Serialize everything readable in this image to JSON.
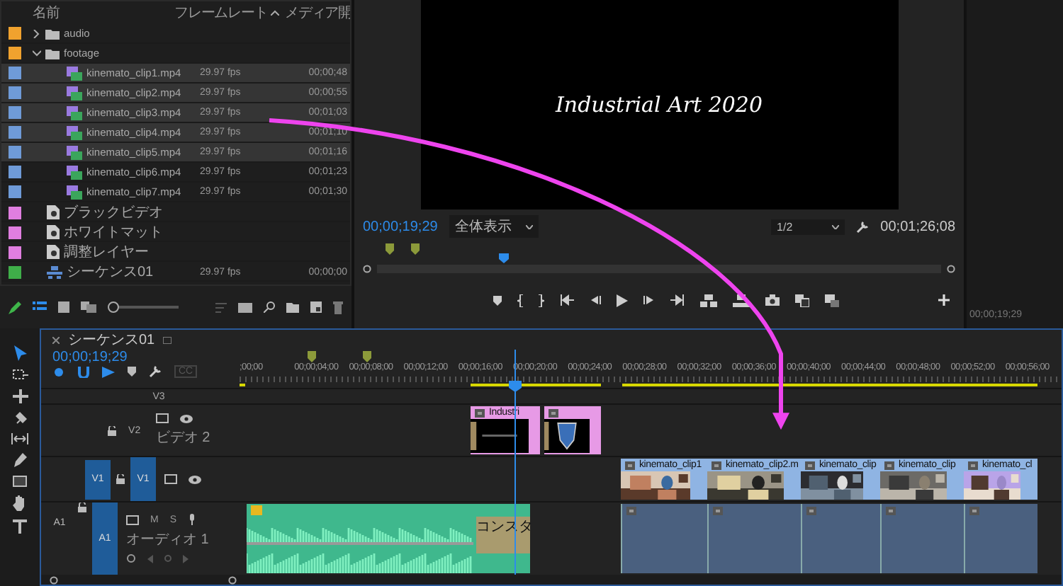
{
  "project": {
    "columns": [
      "名前",
      "フレームレート",
      "メディア開"
    ],
    "zoom_slider": {
      "level": 0
    },
    "items": [
      {
        "kind": "folder",
        "name": "audio",
        "color": "#f0a22e",
        "expanded": false,
        "selected": false
      },
      {
        "kind": "folder",
        "name": "footage",
        "color": "#f0a22e",
        "expanded": true,
        "selected": false,
        "children": [
          {
            "kind": "clip",
            "name": "kinemato_clip1.mp4",
            "rate": "29.97 fps",
            "duration": "00;00;48",
            "color": "#6f9bd8",
            "selected": true
          },
          {
            "kind": "clip",
            "name": "kinemato_clip2.mp4",
            "rate": "29.97 fps",
            "duration": "00;00;55",
            "color": "#6f9bd8",
            "selected": true
          },
          {
            "kind": "clip",
            "name": "kinemato_clip3.mp4",
            "rate": "29.97 fps",
            "duration": "00;01;03",
            "color": "#6f9bd8",
            "selected": true
          },
          {
            "kind": "clip",
            "name": "kinemato_clip4.mp4",
            "rate": "29.97 fps",
            "duration": "00;01;10",
            "color": "#6f9bd8",
            "selected": true
          },
          {
            "kind": "clip",
            "name": "kinemato_clip5.mp4",
            "rate": "29.97 fps",
            "duration": "00;01;16",
            "color": "#6f9bd8",
            "selected": true
          },
          {
            "kind": "clip",
            "name": "kinemato_clip6.mp4",
            "rate": "29.97 fps",
            "duration": "00;01;23",
            "color": "#6f9bd8",
            "selected": false
          },
          {
            "kind": "clip",
            "name": "kinemato_clip7.mp4",
            "rate": "29.97 fps",
            "duration": "00;01;30",
            "color": "#6f9bd8",
            "selected": false
          }
        ]
      },
      {
        "kind": "item",
        "name": "ブラックビデオ",
        "color": "#e07ee0",
        "selected": false
      },
      {
        "kind": "item",
        "name": "ホワイトマット",
        "color": "#e07ee0",
        "selected": false
      },
      {
        "kind": "item",
        "name": "調整レイヤー",
        "color": "#e07ee0",
        "selected": false
      },
      {
        "kind": "sequence",
        "name": "シーケンス01",
        "rate": "29.97 fps",
        "duration": "00;00;00",
        "color": "#3fae49",
        "selected": false
      }
    ]
  },
  "monitor": {
    "title": "Industrial Art 2020",
    "timecode": "00;00;19;29",
    "zoom": "全体表示",
    "resolution": "1/2",
    "duration": "00;01;26;08",
    "level": 0.225
  },
  "side_panel": {
    "timecode": "00;00;19;29"
  },
  "timeline": {
    "tab": "シーケンス01",
    "timecode": "00;00;19;29",
    "captions": "CC",
    "level": 0.334,
    "ruler": [
      ";00;00",
      "00;00;04;00",
      "00;00;08;00",
      "00;00;12;00",
      "00;00;16;00",
      "00;00;20;00",
      "00;00;24;00",
      "00;00;28;00",
      "00;00;32;00",
      "00;00;36;00",
      "00;00;40;00",
      "00;00;44;00",
      "00;00;48;00",
      "00;00;52;00",
      "00;00;56;00"
    ],
    "tracks": [
      {
        "kind": "video",
        "name": "V3",
        "targeted": false
      },
      {
        "kind": "video",
        "name": "V2",
        "label": "ビデオ 2",
        "targeted": false,
        "clips": [
          {
            "kind": "graphic",
            "label": "Industri"
          },
          {
            "kind": "graphic"
          }
        ]
      },
      {
        "kind": "video",
        "name": "V1",
        "source_patch": {
          "label": "V1",
          "on": true
        },
        "targeted": true,
        "clips": [
          {
            "kind": "video",
            "label": "kinemato_clip1"
          },
          {
            "kind": "video",
            "label": "kinemato_clip2.m"
          },
          {
            "kind": "video",
            "label": "kinemato_clip"
          },
          {
            "kind": "video",
            "label": "kinemato_clip"
          },
          {
            "kind": "video",
            "label": "kinemato_cl"
          }
        ]
      },
      {
        "kind": "audio",
        "name": "A1",
        "source_patch": {
          "label": "A1",
          "on": false
        },
        "label": "オーディオ 1",
        "mute": "M",
        "solo": "S",
        "targeted": true,
        "clips": [
          {
            "kind": "audio",
            "transition": "コンスタ"
          },
          {
            "kind": "linked"
          },
          {
            "kind": "linked"
          },
          {
            "kind": "linked"
          },
          {
            "kind": "linked"
          },
          {
            "kind": "linked"
          }
        ]
      }
    ]
  }
}
